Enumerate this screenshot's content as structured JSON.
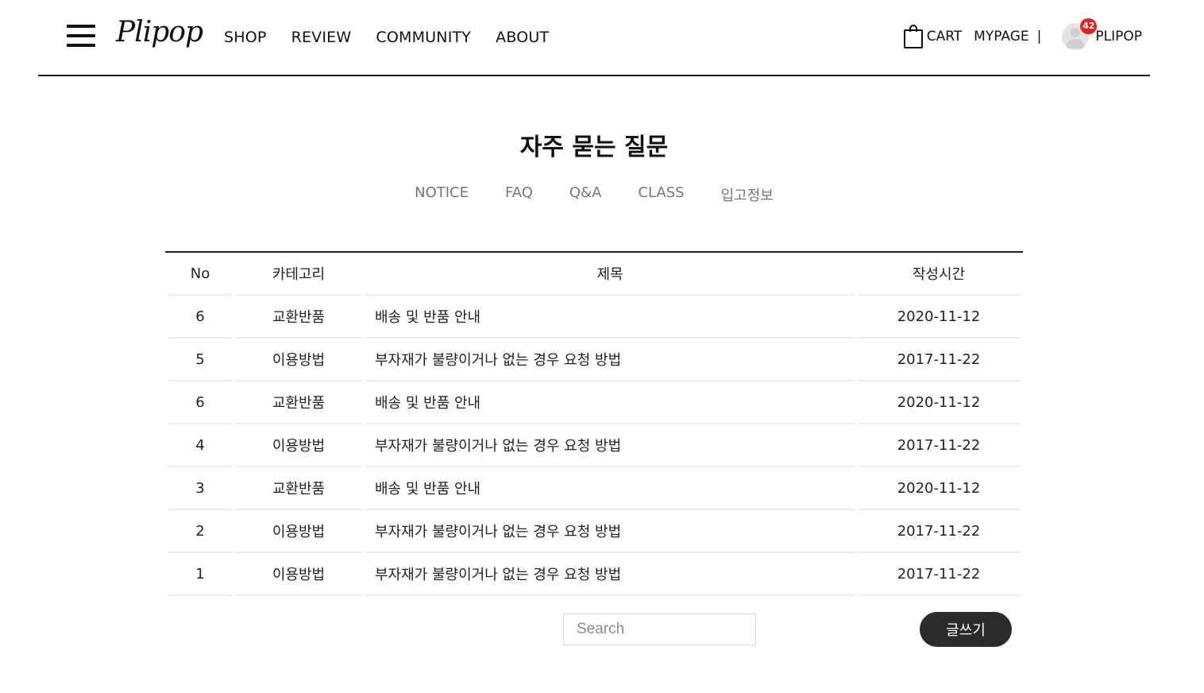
{
  "header": {
    "logo": "Plipop",
    "nav": [
      "SHOP",
      "REVIEW",
      "COMMUNITY",
      "ABOUT"
    ],
    "cart_label": "CART",
    "mypage_label": "MYPAGE",
    "separator": "|",
    "notification_count": "42",
    "user_name": "PLIPOP"
  },
  "page": {
    "title": "자주 묻는 질문",
    "tabs": [
      "NOTICE",
      "FAQ",
      "Q&A",
      "CLASS",
      "입고정보"
    ]
  },
  "table": {
    "columns": [
      "No",
      "카테고리",
      "제목",
      "작성시간"
    ],
    "rows": [
      {
        "no": "6",
        "category": "교환반품",
        "title": "배송 및 반품 안내",
        "date": "2020-11-12"
      },
      {
        "no": "5",
        "category": "이용방법",
        "title": "부자재가 불량이거나 없는 경우 요청 방법",
        "date": "2017-11-22"
      },
      {
        "no": "6",
        "category": "교환반품",
        "title": "배송 및 반품 안내",
        "date": "2020-11-12"
      },
      {
        "no": "4",
        "category": "이용방법",
        "title": "부자재가 불량이거나 없는 경우 요청 방법",
        "date": "2017-11-22"
      },
      {
        "no": "3",
        "category": "교환반품",
        "title": "배송 및 반품 안내",
        "date": "2020-11-12"
      },
      {
        "no": "2",
        "category": "이용방법",
        "title": "부자재가 불량이거나 없는 경우 요청 방법",
        "date": "2017-11-22"
      },
      {
        "no": "1",
        "category": "이용방법",
        "title": "부자재가 불량이거나 없는 경우 요청 방법",
        "date": "2017-11-22"
      }
    ]
  },
  "search": {
    "placeholder": "Search",
    "value": ""
  },
  "write_button": "글쓰기",
  "colors": {
    "text": "#111111",
    "muted": "#777777",
    "button": "#2b2b2b",
    "badge": "#e02424"
  }
}
